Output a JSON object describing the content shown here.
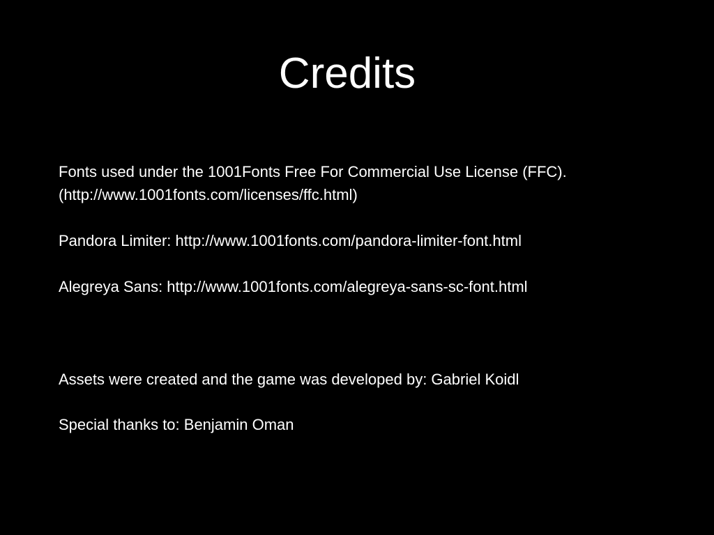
{
  "screen": {
    "title": "Credits",
    "background_color": "#000000",
    "text_color": "#ffffff"
  },
  "credits": {
    "license_line_1": "Fonts used under the 1001Fonts Free For Commercial Use License (FFC).",
    "license_line_2": "(http://www.1001fonts.com/licenses/ffc.html)",
    "font_pandora": "Pandora Limiter: http://www.1001fonts.com/pandora-limiter-font.html",
    "font_alegreya": "Alegreya Sans: http://www.1001fonts.com/alegreya-sans-sc-font.html",
    "developer": "Assets were created and the game was developed by: Gabriel Koidl",
    "thanks": "Special thanks to: Benjamin Oman"
  }
}
